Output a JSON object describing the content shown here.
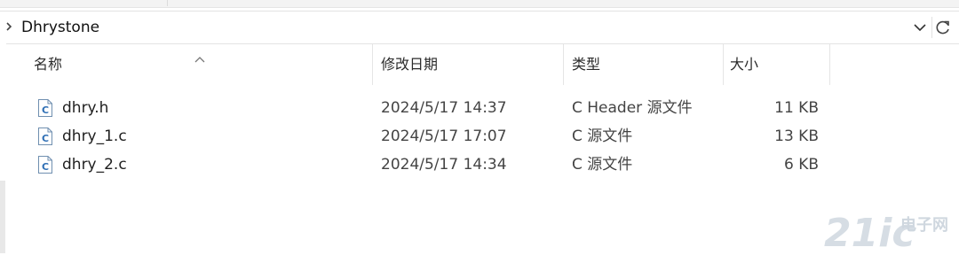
{
  "address_bar": {
    "path_label": "Dhrystone"
  },
  "columns": {
    "name": "名称",
    "date_modified": "修改日期",
    "type": "类型",
    "size": "大小"
  },
  "files": [
    {
      "name": "dhry.h",
      "date_modified": "2024/5/17 14:37",
      "type": "C Header 源文件",
      "size": "11 KB"
    },
    {
      "name": "dhry_1.c",
      "date_modified": "2024/5/17 17:07",
      "type": "C 源文件",
      "size": "13 KB"
    },
    {
      "name": "dhry_2.c",
      "date_modified": "2024/5/17 14:34",
      "type": "C 源文件",
      "size": "6 KB"
    }
  ],
  "icons": {
    "file": "c-source-file-icon",
    "crumb": "chevron-right-icon",
    "dropdown": "chevron-down-icon",
    "refresh": "refresh-icon"
  },
  "watermark": {
    "brand": "21ic",
    "site": "电子网"
  },
  "colors": {
    "icon_blue": "#2f6fb5",
    "watermark": "#c9d3dc"
  }
}
